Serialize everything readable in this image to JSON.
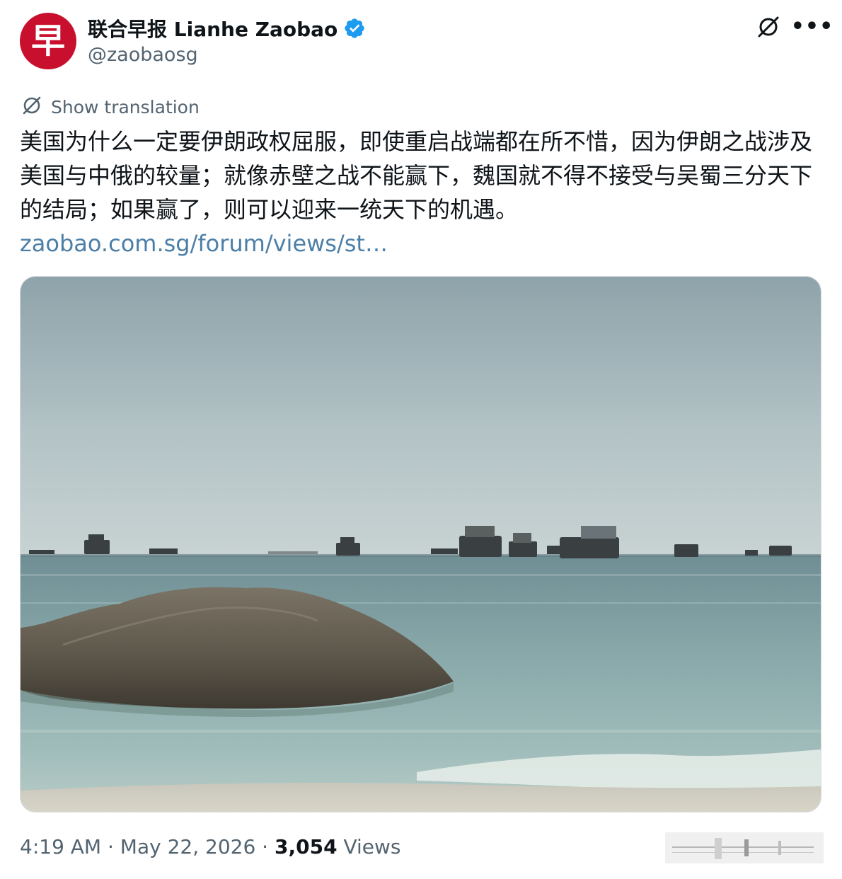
{
  "author": {
    "avatar_glyph": "早",
    "avatar_color": "#c8102e",
    "display_name": "联合早报 Lianhe Zaobao",
    "handle": "@zaobaosg",
    "verified_icon": "verified-badge-icon"
  },
  "actions": {
    "grok_icon": "grok-icon",
    "more_label": "•••"
  },
  "translation": {
    "label": "Show translation",
    "icon": "translate-globe-icon"
  },
  "tweet": {
    "text": "美国为什么一定要伊朗政权屈服，即使重启战端都在所不惜，因为伊朗之战涉及美国与中俄的较量；就像赤壁之战不能赢下，魏国就不得不接受与吴蜀三分天下的结局；如果赢了，则可以迎来一统天下的机遇。",
    "link": "zaobao.com.sg/forum/views/st…"
  },
  "meta": {
    "time": "4:19 AM",
    "separator_1": " · ",
    "date": "May 22, 2026",
    "separator_2": " · ",
    "views_count": "3,054",
    "views_label": " Views"
  },
  "colors": {
    "link": "#4c7fa8",
    "secondary_text": "#536471",
    "primary_text": "#0f1419",
    "verified": "#1d9bf0"
  }
}
